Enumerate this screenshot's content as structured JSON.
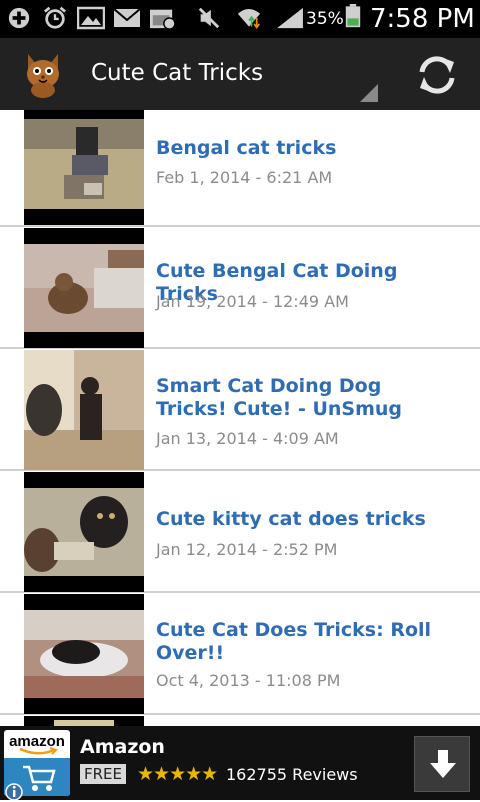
{
  "status_bar": {
    "battery_percent": "35%",
    "time": "7:58 PM"
  },
  "action_bar": {
    "title": "Cute Cat Tricks",
    "refresh_icon": "refresh-icon",
    "app_icon": "cat-face-icon"
  },
  "videos": [
    {
      "title": "Bengal cat tricks",
      "date": "Feb 1, 2014 - 6:21 AM"
    },
    {
      "title": "Cute Bengal Cat Doing Tricks",
      "date": "Jan 19, 2014 - 12:49 AM"
    },
    {
      "title": "Smart Cat Doing Dog Tricks! Cute! - UnSmug",
      "date": "Jan 13, 2014 - 4:09 AM"
    },
    {
      "title": "Cute kitty cat does tricks",
      "date": "Jan 12, 2014 - 2:52 PM"
    },
    {
      "title": "Cute Cat Does Tricks: Roll Over!!",
      "date": "Oct 4, 2013 - 11:08 PM"
    }
  ],
  "ad": {
    "logo_text": "amazon",
    "name": "Amazon",
    "price": "FREE",
    "rating": 4.5,
    "stars": "★★★★★",
    "reviews": "162755 Reviews",
    "download_icon": "download-arrow-icon",
    "info_icon": "info-icon"
  },
  "colors": {
    "title_blue": "#2e6db4",
    "date_gray": "#8c8c8c",
    "action_bar": "#222222",
    "star_gold": "#e6b800"
  }
}
